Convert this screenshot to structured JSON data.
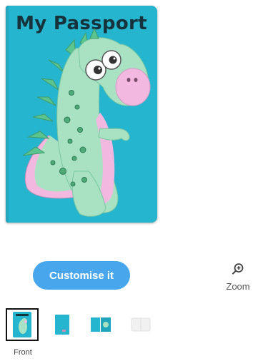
{
  "product": {
    "title": "My Passport",
    "image_icon": "dinosaur-illustration"
  },
  "actions": {
    "customise_label": "Customise it",
    "zoom_label": "Zoom",
    "zoom_icon": "zoom-in-icon"
  },
  "thumbnails": {
    "selected_label": "Front",
    "items": [
      "front",
      "inside",
      "open",
      "back"
    ]
  },
  "colors": {
    "cover": "#26b5cf",
    "button": "#48a7ec",
    "dino_body": "#a8e2c3",
    "dino_belly": "#f2b8e0"
  }
}
